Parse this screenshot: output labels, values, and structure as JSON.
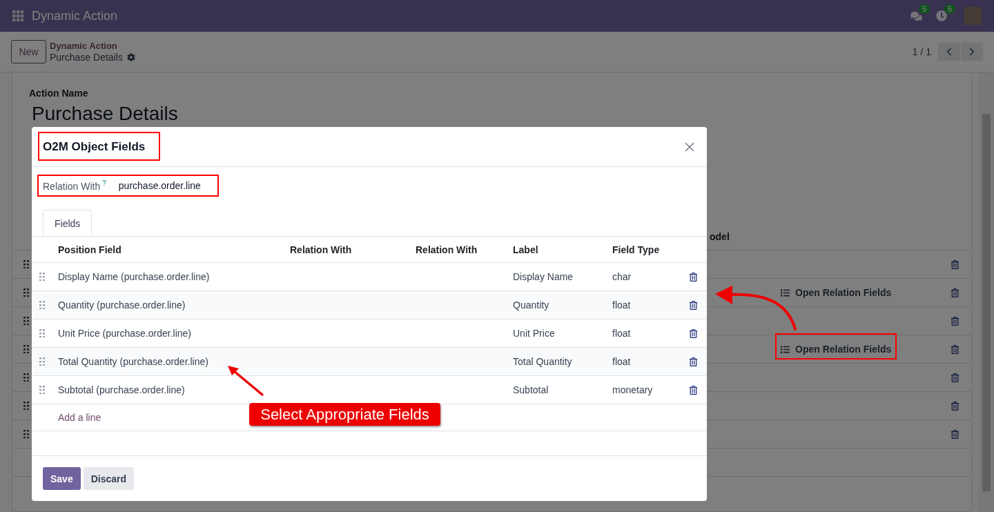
{
  "navbar": {
    "app_title": "Dynamic Action",
    "messages_badge": "5",
    "activities_badge": "5"
  },
  "control_panel": {
    "new_button": "New",
    "breadcrumb_parent": "Dynamic Action",
    "breadcrumb_current": "Purchase Details",
    "pager": "1 / 1"
  },
  "form": {
    "action_name_label": "Action Name",
    "action_name": "Purchase Details",
    "list_header": "odel",
    "rows": [
      {},
      {
        "link": "Open Relation Fields"
      },
      {},
      {
        "link": "Open Relation Fields"
      },
      {},
      {},
      {}
    ]
  },
  "dialog": {
    "title": "O2M Object Fields",
    "relation_label": "Relation With",
    "help_mark": "?",
    "relation_value": "purchase.order.line",
    "tabs": [
      {
        "label": "Fields",
        "selected": true
      }
    ],
    "columns": [
      "Position Field",
      "Relation With",
      "Relation With",
      "Label",
      "Field Type"
    ],
    "rows": [
      {
        "position_field": "Display Name (purchase.order.line)",
        "label": "Display Name",
        "field_type": "char"
      },
      {
        "position_field": "Quantity (purchase.order.line)",
        "label": "Quantity",
        "field_type": "float"
      },
      {
        "position_field": "Unit Price (purchase.order.line)",
        "label": "Unit Price",
        "field_type": "float"
      },
      {
        "position_field": "Total Quantity (purchase.order.line)",
        "label": "Total Quantity",
        "field_type": "float"
      },
      {
        "position_field": "Subtotal (purchase.order.line)",
        "label": "Subtotal",
        "field_type": "monetary"
      }
    ],
    "add_line": "Add a line",
    "buttons": [
      {
        "label": "Save",
        "kind": "primary"
      },
      {
        "label": "Discard",
        "kind": "secondary"
      }
    ]
  },
  "annotation": {
    "callout": "Select Appropriate Fields"
  }
}
